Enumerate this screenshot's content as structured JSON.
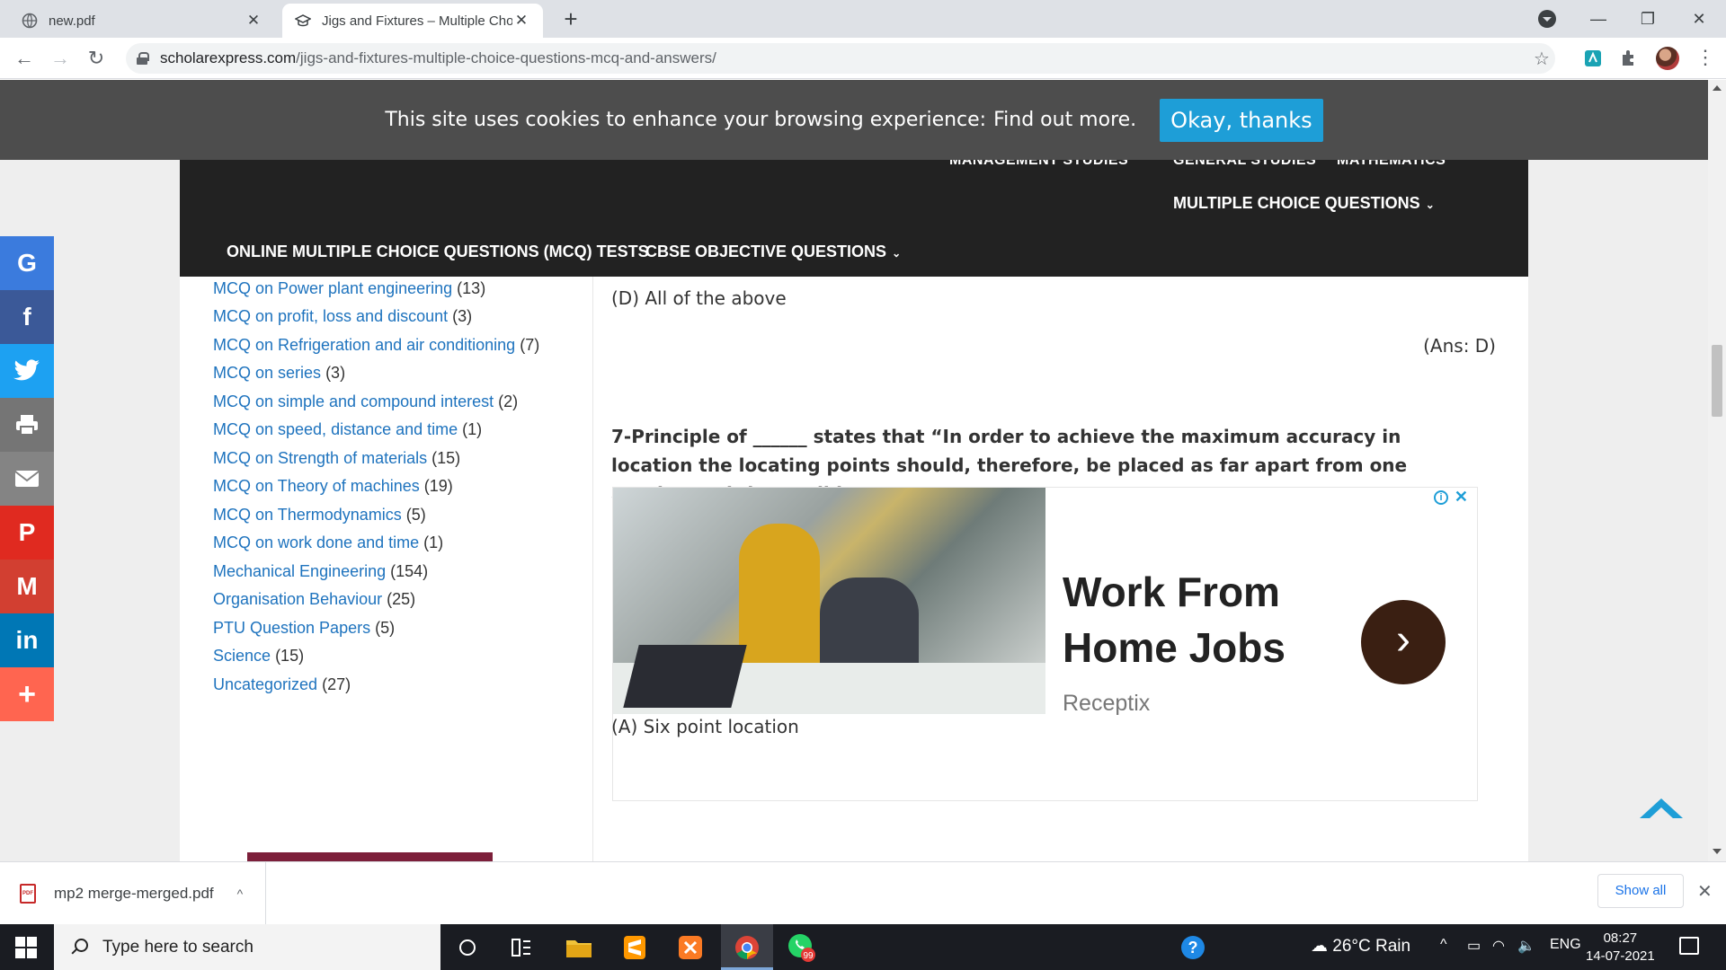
{
  "browser": {
    "tabs": [
      {
        "title": "new.pdf",
        "active": false
      },
      {
        "title": "Jigs and Fixtures – Multiple Choice Questions",
        "active": true
      }
    ],
    "new_tab": "+",
    "url_host": "scholarexpress.com",
    "url_path": "/jigs-and-fixtures-multiple-choice-questions-mcq-and-answers/"
  },
  "cookie": {
    "text": "This site uses cookies to enhance your browsing experience:",
    "link": "Find out more.",
    "button": "Okay, thanks"
  },
  "nav": {
    "cut_items": [
      "MANAGEMENT STUDIES",
      "GENERAL STUDIES",
      "MATHEMATICS"
    ],
    "mcq": "MULTIPLE CHOICE QUESTIONS",
    "online_tests": "ONLINE MULTIPLE CHOICE QUESTIONS (MCQ) TESTS",
    "cbse": "CBSE OBJECTIVE QUESTIONS"
  },
  "sidebar": {
    "categories": [
      {
        "name": "MCQ on Power plant engineering",
        "count": "(13)"
      },
      {
        "name": "MCQ on profit, loss and discount",
        "count": "(3)"
      },
      {
        "name": "MCQ on Refrigeration and air conditioning",
        "count": "(7)"
      },
      {
        "name": "MCQ on series",
        "count": "(3)"
      },
      {
        "name": "MCQ on simple and compound interest",
        "count": "(2)"
      },
      {
        "name": "MCQ on speed, distance and time",
        "count": "(1)"
      },
      {
        "name": "MCQ on Strength of materials",
        "count": "(15)"
      },
      {
        "name": "MCQ on Theory of machines",
        "count": "(19)"
      },
      {
        "name": "MCQ on Thermodynamics",
        "count": "(5)"
      },
      {
        "name": "MCQ on work done and time",
        "count": "(1)"
      },
      {
        "name": "Mechanical Engineering",
        "count": "(154)"
      },
      {
        "name": "Organisation Behaviour",
        "count": "(25)"
      },
      {
        "name": "PTU Question Papers",
        "count": "(5)"
      },
      {
        "name": "Science",
        "count": "(15)"
      },
      {
        "name": "Uncategorized",
        "count": "(27)"
      }
    ]
  },
  "article": {
    "prev_option": "(D) All of the above",
    "answer": "(Ans: D)",
    "question": "7-Principle of ______ states that “In order to achieve the maximum accuracy in location the locating points should, therefore, be placed as far apart from one another as it is possible”.",
    "option_a": "(A) Six point location"
  },
  "ad": {
    "title_line1": "Work From",
    "title_line2": "Home Jobs",
    "advertiser": "Receptix",
    "arrow": "›",
    "info": "i",
    "close": "✕"
  },
  "share": [
    {
      "icon": "google-icon",
      "glyph": "G",
      "color": "#3b7bdd"
    },
    {
      "icon": "facebook-icon",
      "glyph": "f",
      "color": "#3b5998"
    },
    {
      "icon": "twitter-icon",
      "glyph": "🐦",
      "color": "#1da1f2"
    },
    {
      "icon": "print-icon",
      "glyph": "⎙",
      "color": "#757575"
    },
    {
      "icon": "email-icon",
      "glyph": "✉",
      "color": "#848484"
    },
    {
      "icon": "pinterest-icon",
      "glyph": "P",
      "color": "#e02a20"
    },
    {
      "icon": "gmail-icon",
      "glyph": "M",
      "color": "#d23f31"
    },
    {
      "icon": "linkedin-icon",
      "glyph": "in",
      "color": "#0077b5"
    },
    {
      "icon": "more-icon",
      "glyph": "+",
      "color": "#ff6550"
    }
  ],
  "download": {
    "filename": "mp2 merge-merged.pdf",
    "pdf_label": "PDF",
    "show_all": "Show all",
    "close": "✕"
  },
  "taskbar": {
    "search_placeholder": "Type here to search",
    "weather": "26°C  Rain",
    "lang": "ENG",
    "time": "08:27",
    "date": "14-07-2021",
    "whatsapp_badge": "99"
  }
}
